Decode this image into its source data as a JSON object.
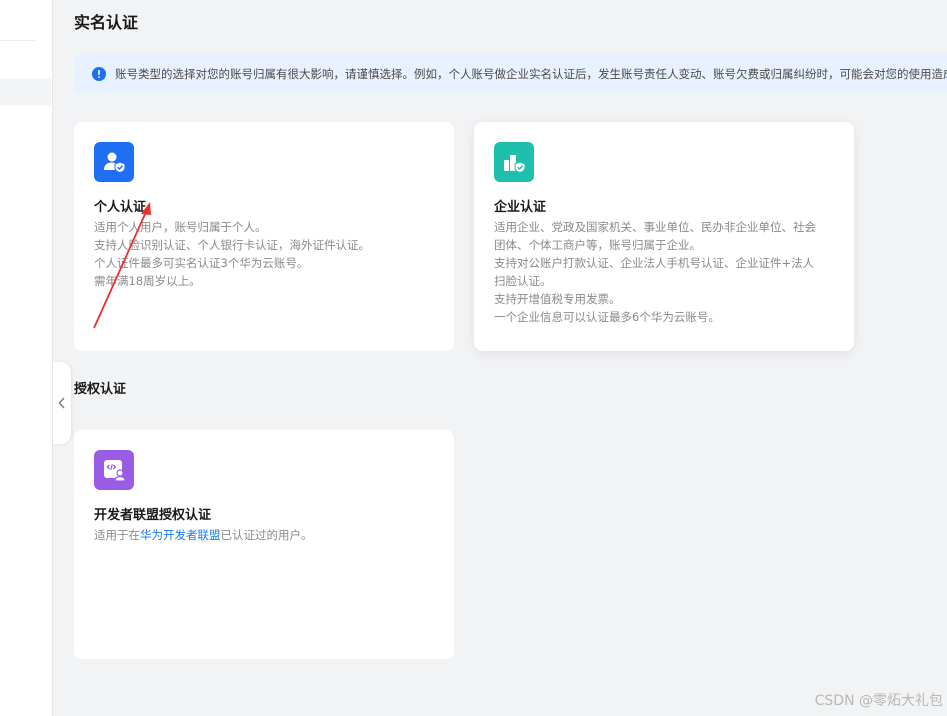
{
  "page": {
    "title": "实名认证",
    "notice": "账号类型的选择对您的账号归属有很大影响，请谨慎选择。例如，个人账号做企业实名认证后，发生账号责任人变动、账号欠费或归属纠纷时，可能会对您的使用造成影响。"
  },
  "cards": {
    "personal": {
      "title": "个人认证",
      "desc": [
        "适用个人用户，账号归属于个人。",
        "支持人脸识别认证、个人银行卡认证，海外证件认证。",
        "个人证件最多可实名认证3个华为云账号。",
        "需年满18周岁以上。"
      ]
    },
    "enterprise": {
      "title": "企业认证",
      "desc": [
        "适用企业、党政及国家机关、事业单位、民办非企业单位、社会",
        "团体、个体工商户等，账号归属于企业。",
        "支持对公账户打款认证、企业法人手机号认证、企业证件+法人",
        "扫脸认证。",
        "支持开增值税专用发票。",
        "一个企业信息可以认证最多6个华为云账号。"
      ]
    },
    "developer": {
      "title": "开发者联盟授权认证",
      "desc_prefix": "适用于在",
      "desc_link": "华为开发者联盟",
      "desc_suffix": "已认证过的用户。"
    }
  },
  "sections": {
    "authorized": "授权认证"
  },
  "watermark": "CSDN @零炻大礼包",
  "colors": {
    "personal_icon": "#1f6ff2",
    "enterprise_icon": "#1fbfae",
    "developer_icon": "#9b5ce5",
    "accent": "#1a7bf2",
    "annotation_arrow": "#e8322d"
  },
  "icons": {
    "notice": "info-icon",
    "personal": "person-shield-icon",
    "enterprise": "building-shield-icon",
    "developer": "code-user-icon",
    "collapse": "chevron-left-icon"
  }
}
